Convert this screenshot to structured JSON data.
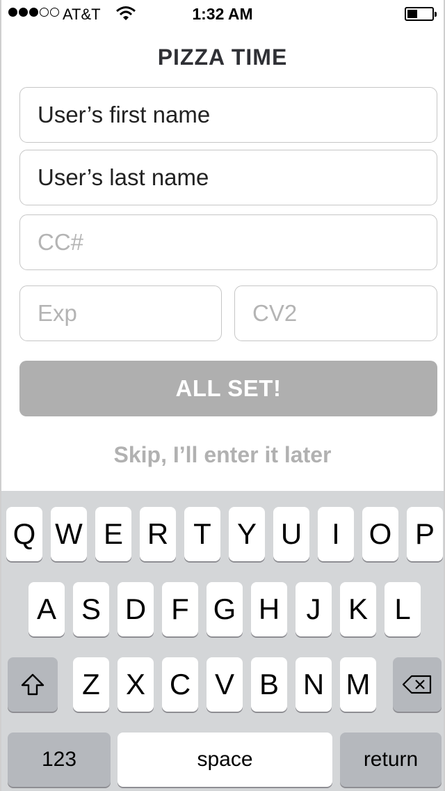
{
  "status_bar": {
    "carrier": "AT&T",
    "time": "1:32 AM",
    "signal_bars_filled": 3,
    "signal_bars_total": 5,
    "wifi_icon": "wifi-icon",
    "battery_icon": "battery-icon",
    "battery_level": 0.4
  },
  "app": {
    "title": "PIZZA TIME"
  },
  "form": {
    "first_name": {
      "value": "User’s first name"
    },
    "last_name": {
      "value": "User’s last name"
    },
    "cc": {
      "placeholder": "CC#"
    },
    "exp": {
      "placeholder": "Exp"
    },
    "cv2": {
      "placeholder": "CV2"
    },
    "submit_label": "ALL SET!",
    "skip_label": "Skip, I’ll enter it later"
  },
  "keyboard": {
    "row1": [
      "Q",
      "W",
      "E",
      "R",
      "T",
      "Y",
      "U",
      "I",
      "O",
      "P"
    ],
    "row2": [
      "A",
      "S",
      "D",
      "F",
      "G",
      "H",
      "J",
      "K",
      "L"
    ],
    "row3": [
      "Z",
      "X",
      "C",
      "V",
      "B",
      "N",
      "M"
    ],
    "shift_icon": "shift-icon",
    "backspace_icon": "backspace-icon",
    "numbers_label": "123",
    "space_label": "space",
    "return_label": "return"
  },
  "colors": {
    "title": "#2f3035",
    "button_disabled": "#afafaf",
    "skip_text": "#b1b1b1",
    "keyboard_bg": "#d4d6d8"
  }
}
